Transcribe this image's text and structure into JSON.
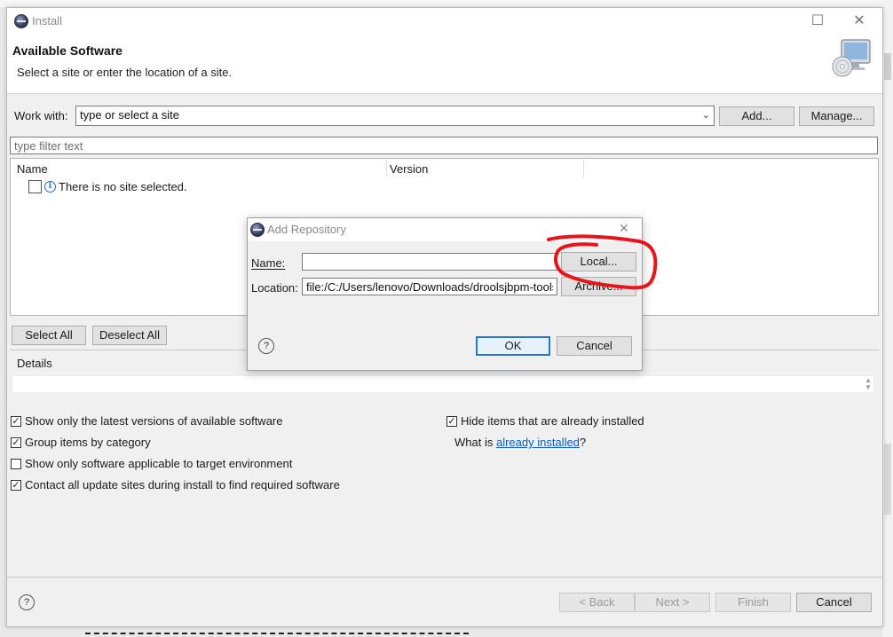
{
  "window": {
    "title": "Install",
    "controls": {
      "minimize": "–",
      "maximize": "☐",
      "close": "✕"
    }
  },
  "header": {
    "title": "Available Software",
    "subtitle": "Select a site or enter the location of a site."
  },
  "work_with": {
    "label": "Work with:",
    "value": "type or select a site",
    "add_label": "Add...",
    "manage_label": "Manage..."
  },
  "filter": {
    "placeholder": "type filter text"
  },
  "table": {
    "columns": [
      "Name",
      "Version"
    ],
    "rows": [
      {
        "name": "There is no site selected.",
        "version": ""
      }
    ]
  },
  "selection": {
    "select_all": "Select All",
    "deselect_all": "Deselect All"
  },
  "details": {
    "label": "Details"
  },
  "options": {
    "left": [
      {
        "label": "Show only the latest versions of available software",
        "checked": true
      },
      {
        "label": "Group items by category",
        "checked": true
      },
      {
        "label": "Show only software applicable to target environment",
        "checked": false
      },
      {
        "label": "Contact all update sites during install to find required software",
        "checked": true
      }
    ],
    "hide_installed": {
      "label": "Hide items that are already installed",
      "checked": true
    },
    "what_is": {
      "prefix": "What is ",
      "link": "already installed",
      "suffix": "?"
    }
  },
  "footer": {
    "back": "< Back",
    "next": "Next >",
    "finish": "Finish",
    "cancel": "Cancel"
  },
  "add_repository": {
    "title": "Add Repository",
    "name_label": "Name:",
    "name_value": "",
    "location_label": "Location:",
    "location_value": "file:/C:/Users/lenovo/Downloads/droolsjbpm-tools",
    "local_label": "Local...",
    "archive_label": "Archive...",
    "ok_label": "OK",
    "cancel_label": "Cancel"
  },
  "colors": {
    "annotation": "#e8141b",
    "default_button_border": "#2a76c6",
    "link": "#0b5bc9"
  }
}
